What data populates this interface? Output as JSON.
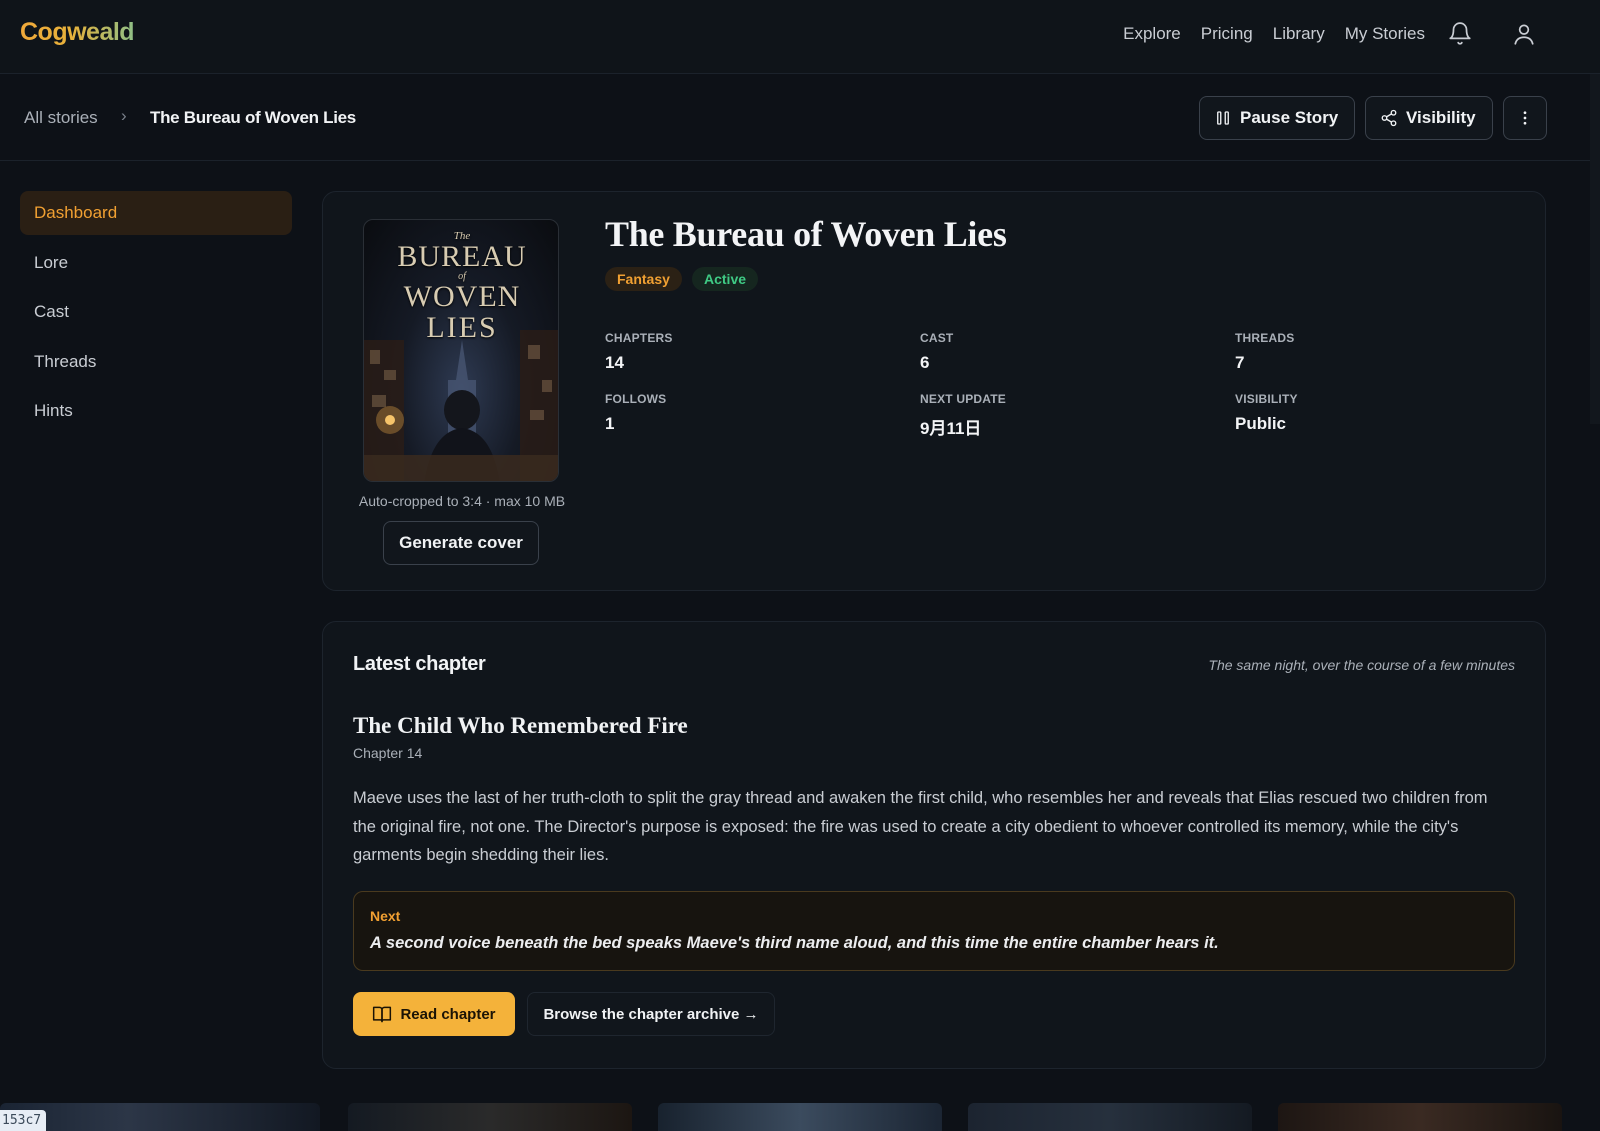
{
  "app": {
    "name": "Cogweald"
  },
  "nav": {
    "links": [
      "Explore",
      "Pricing",
      "Library",
      "My Stories"
    ],
    "icons": [
      "bell-icon",
      "user-icon"
    ]
  },
  "breadcrumb": {
    "root": "All stories",
    "current": "The Bureau of Woven Lies"
  },
  "actions": {
    "pause_label": "Pause Story",
    "visibility_label": "Visibility"
  },
  "sidebar": {
    "items": [
      {
        "label": "Dashboard",
        "active": true
      },
      {
        "label": "Lore"
      },
      {
        "label": "Cast"
      },
      {
        "label": "Threads"
      },
      {
        "label": "Hints"
      }
    ]
  },
  "story": {
    "title": "The Bureau of Woven Lies",
    "cover_title": {
      "the": "The",
      "line1": "BUREAU",
      "of": "of",
      "line2": "WOVEN",
      "line3": "LIES"
    },
    "cover_note": "Auto-cropped to 3:4 · max 10 MB",
    "generate_label": "Generate cover",
    "genre": "Fantasy",
    "status": "Active",
    "stats": [
      {
        "label": "CHAPTERS",
        "value": "14"
      },
      {
        "label": "CAST",
        "value": "6"
      },
      {
        "label": "THREADS",
        "value": "7"
      },
      {
        "label": "FOLLOWS",
        "value": "1"
      },
      {
        "label": "NEXT UPDATE",
        "value": "9月11日"
      },
      {
        "label": "VISIBILITY",
        "value": "Public"
      }
    ]
  },
  "latest": {
    "heading": "Latest chapter",
    "timeframe": "The same night, over the course of a few minutes",
    "chapter_title": "The Child Who Remembered Fire",
    "chapter_number": "Chapter 14",
    "summary": "Maeve uses the last of her truth-cloth to split the gray thread and awaken the first child, who resembles her and reveals that Elias rescued two children from the original fire, not one. The Director's purpose is exposed: the fire was used to create a city obedient to whoever controlled its memory, while the city's garments begin shedding their lies.",
    "next_label": "Next",
    "next_text": "A second voice beneath the bed speaks Maeve's third name aloud, and this time the entire chamber hears it.",
    "read_label": "Read chapter",
    "archive_label": "Browse the chapter archive →"
  },
  "debug_badge": "153c7",
  "colors": {
    "accent": "#f1a032",
    "active_green": "#3fca84",
    "background": "#0d1117"
  }
}
